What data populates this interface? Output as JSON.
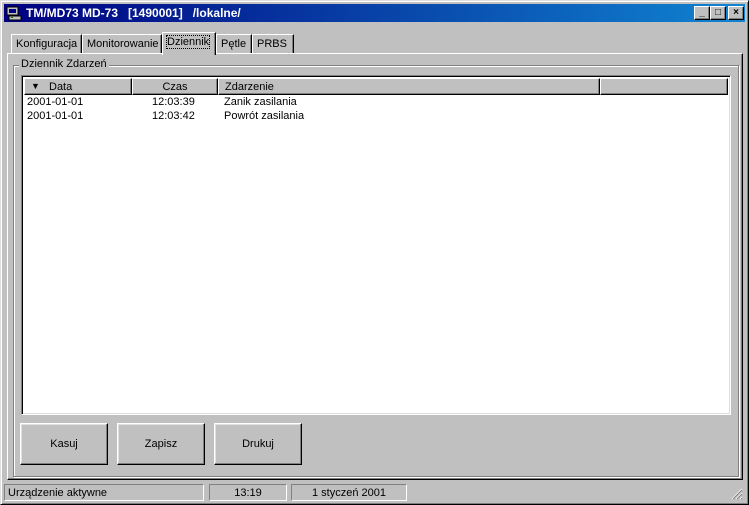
{
  "window": {
    "title": "TM/MD73 MD-73   [1490001]   /lokalne/",
    "minimize_glyph": "_",
    "maximize_glyph": "□",
    "close_glyph": "×"
  },
  "tabs": [
    {
      "label": "Konfiguracja"
    },
    {
      "label": "Monitorowanie"
    },
    {
      "label": "Dziennik",
      "active": true
    },
    {
      "label": "Pętle"
    },
    {
      "label": "PRBS"
    }
  ],
  "group": {
    "title": "Dziennik Zdarzeń"
  },
  "table": {
    "columns": [
      "Data",
      "Czas",
      "Zdarzenie",
      ""
    ],
    "sort_icon": "sort-down-icon",
    "rows": [
      {
        "date": "2001-01-01",
        "time": "12:03:39",
        "event": "Zanik zasilania"
      },
      {
        "date": "2001-01-01",
        "time": "12:03:42",
        "event": "Powrót zasilania"
      }
    ]
  },
  "buttons": {
    "clear": "Kasuj",
    "save": "Zapisz",
    "print": "Drukuj"
  },
  "status": {
    "state": "Urządzenie aktywne",
    "clock": "13:19",
    "date": "1 styczeń 2001"
  },
  "colors": {
    "title_bar_start": "#000080",
    "title_bar_end": "#1084d0",
    "face": "#c0c0c0"
  }
}
